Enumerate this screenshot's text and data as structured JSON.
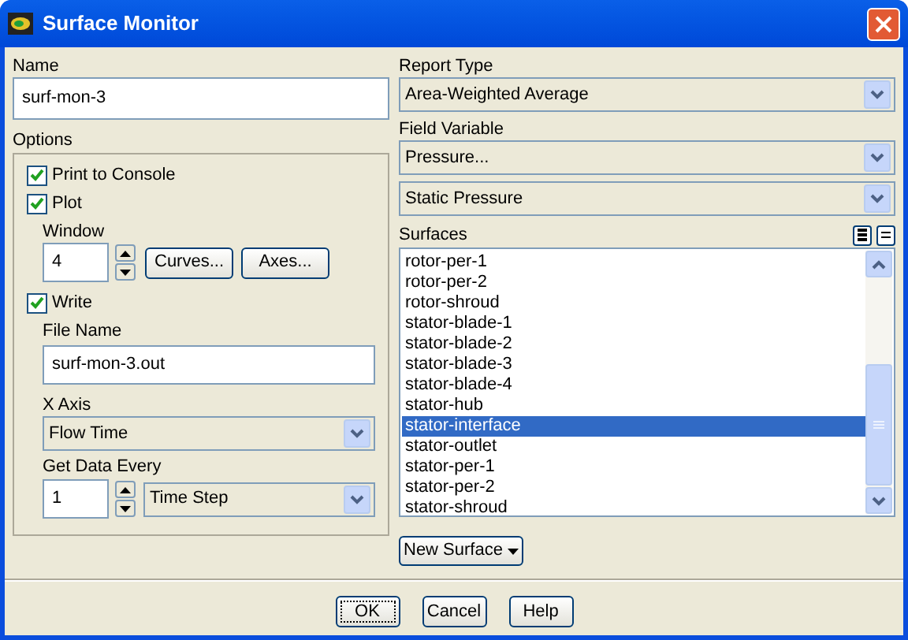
{
  "window": {
    "title": "Surface Monitor"
  },
  "name": {
    "label": "Name",
    "value": "surf-mon-3"
  },
  "options": {
    "label": "Options",
    "print_to_console": {
      "label": "Print to Console",
      "checked": true
    },
    "plot": {
      "label": "Plot",
      "checked": true
    },
    "window": {
      "label": "Window",
      "value": "4"
    },
    "curves_button": "Curves...",
    "axes_button": "Axes...",
    "write": {
      "label": "Write",
      "checked": true
    },
    "file_name": {
      "label": "File Name",
      "value": "surf-mon-3.out"
    },
    "x_axis": {
      "label": "X Axis",
      "value": "Flow Time"
    },
    "get_data_every": {
      "label": "Get Data Every",
      "value": "1",
      "unit": "Time Step"
    }
  },
  "report_type": {
    "label": "Report Type",
    "value": "Area-Weighted Average"
  },
  "field_variable": {
    "label": "Field Variable",
    "value": "Pressure...",
    "sub_value": "Static Pressure"
  },
  "surfaces": {
    "label": "Surfaces",
    "items": [
      {
        "label": "rotor-per-1",
        "selected": false
      },
      {
        "label": "rotor-per-2",
        "selected": false
      },
      {
        "label": "rotor-shroud",
        "selected": false
      },
      {
        "label": "stator-blade-1",
        "selected": false
      },
      {
        "label": "stator-blade-2",
        "selected": false
      },
      {
        "label": "stator-blade-3",
        "selected": false
      },
      {
        "label": "stator-blade-4",
        "selected": false
      },
      {
        "label": "stator-hub",
        "selected": false
      },
      {
        "label": "stator-interface",
        "selected": true
      },
      {
        "label": "stator-outlet",
        "selected": false
      },
      {
        "label": "stator-per-1",
        "selected": false
      },
      {
        "label": "stator-per-2",
        "selected": false
      },
      {
        "label": "stator-shroud",
        "selected": false
      }
    ]
  },
  "new_surface_button": "New Surface",
  "buttons": [
    {
      "label": "OK",
      "focused": true
    },
    {
      "label": "Cancel",
      "focused": false
    },
    {
      "label": "Help",
      "focused": false
    }
  ]
}
